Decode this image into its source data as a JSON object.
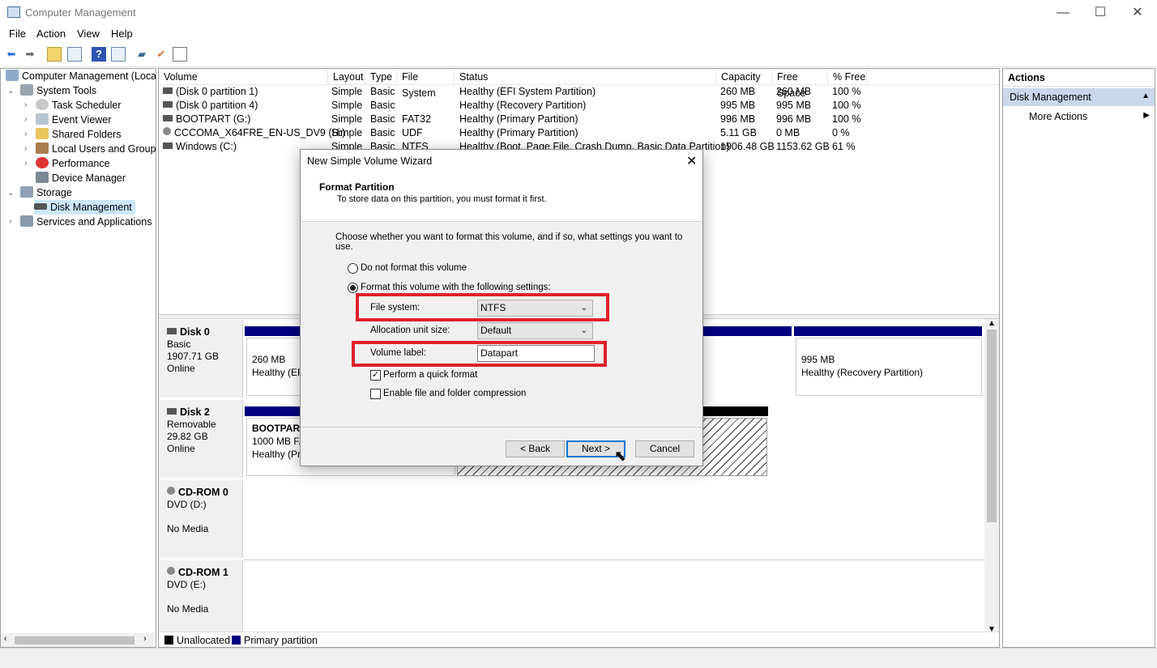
{
  "window": {
    "title": "Computer Management",
    "minimize": "—",
    "maximize": "☐",
    "close": "✕"
  },
  "menu": [
    "File",
    "Action",
    "View",
    "Help"
  ],
  "tree": [
    {
      "label": "Computer Management (Local",
      "icon": "computer-icon"
    },
    {
      "label": "System Tools",
      "icon": "tools-icon"
    },
    {
      "label": "Task Scheduler",
      "icon": "clock-icon"
    },
    {
      "label": "Event Viewer",
      "icon": "event-viewer-icon"
    },
    {
      "label": "Shared Folders",
      "icon": "shared-folder-icon"
    },
    {
      "label": "Local Users and Groups",
      "icon": "users-icon"
    },
    {
      "label": "Performance",
      "icon": "performance-icon"
    },
    {
      "label": "Device Manager",
      "icon": "device-manager-icon"
    },
    {
      "label": "Storage",
      "icon": "storage-icon"
    },
    {
      "label": "Disk Management",
      "icon": "disk-icon"
    },
    {
      "label": "Services and Applications",
      "icon": "services-icon"
    }
  ],
  "columns": [
    "Volume",
    "Layout",
    "Type",
    "File System",
    "Status",
    "Capacity",
    "Free Space",
    "% Free"
  ],
  "volumes": [
    {
      "volume": "(Disk 0 partition 1)",
      "layout": "Simple",
      "type": "Basic",
      "fs": "",
      "status": "Healthy (EFI System Partition)",
      "capacity": "260 MB",
      "free": "260 MB",
      "pct": "100 %"
    },
    {
      "volume": "(Disk 0 partition 4)",
      "layout": "Simple",
      "type": "Basic",
      "fs": "",
      "status": "Healthy (Recovery Partition)",
      "capacity": "995 MB",
      "free": "995 MB",
      "pct": "100 %"
    },
    {
      "volume": "BOOTPART (G:)",
      "layout": "Simple",
      "type": "Basic",
      "fs": "FAT32",
      "status": "Healthy (Primary Partition)",
      "capacity": "996 MB",
      "free": "996 MB",
      "pct": "100 %"
    },
    {
      "volume": "CCCOMA_X64FRE_EN-US_DV9 (H:)",
      "layout": "Simple",
      "type": "Basic",
      "fs": "UDF",
      "status": "Healthy (Primary Partition)",
      "capacity": "5.11 GB",
      "free": "0 MB",
      "pct": "0 %"
    },
    {
      "volume": "Windows (C:)",
      "layout": "Simple",
      "type": "Basic",
      "fs": "NTFS",
      "status": "Healthy (Boot, Page File, Crash Dump, Basic Data Partition)",
      "capacity": "1906.48 GB",
      "free": "1153.62 GB",
      "pct": "61 %"
    }
  ],
  "disks": {
    "disk0": {
      "name": "Disk 0",
      "type": "Basic",
      "size": "1907.71 GB",
      "state": "Online",
      "p1_size": "260 MB",
      "p1_status": "Healthy (EFI",
      "p4_size": "995 MB",
      "p4_status": "Healthy (Recovery Partition)"
    },
    "disk2": {
      "name": "Disk 2",
      "type": "Removable",
      "size": "29.82 GB",
      "state": "Online",
      "p_name": "BOOTPART",
      "p_size": "1000 MB FA",
      "p_status": "Healthy (Pri"
    },
    "cd0": {
      "name": "CD-ROM 0",
      "type": "DVD (D:)",
      "state": "No Media"
    },
    "cd1": {
      "name": "CD-ROM 1",
      "type": "DVD (E:)",
      "state": "No Media"
    }
  },
  "legend": {
    "unallocated": "Unallocated",
    "primary": "Primary partition"
  },
  "actions": {
    "header": "Actions",
    "section": "Disk Management",
    "more": "More Actions"
  },
  "dialog": {
    "title": "New Simple Volume Wizard",
    "heading": "Format Partition",
    "subheading": "To store data on this partition, you must format it first.",
    "instruction": "Choose whether you want to format this volume, and if so, what settings you want to use.",
    "radio_no": "Do not format this volume",
    "radio_yes": "Format this volume with the following settings:",
    "fs_label": "File system:",
    "fs_value": "NTFS",
    "alloc_label": "Allocation unit size:",
    "alloc_value": "Default",
    "vol_label": "Volume label:",
    "vol_value": "Datapart",
    "quick_format": "Perform a quick format",
    "compression": "Enable file and folder compression",
    "back": "< Back",
    "next": "Next >",
    "cancel": "Cancel"
  },
  "colors": {
    "highlight": "#e0202c",
    "primary_partition": "#000080",
    "selection": "#cce8ff"
  }
}
